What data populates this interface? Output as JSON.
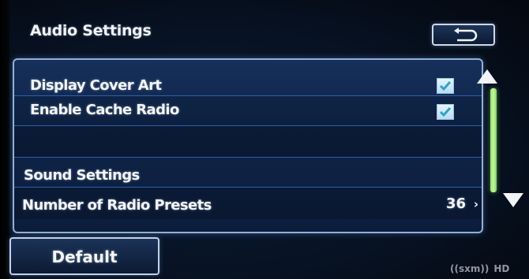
{
  "header": {
    "title": "Audio Settings",
    "back_icon": "back-return-icon"
  },
  "settings": [
    {
      "label": "Display Cover Art",
      "type": "checkbox",
      "checked": true
    },
    {
      "label": "Enable Cache Radio",
      "type": "checkbox",
      "checked": true
    },
    {
      "label": "",
      "type": "empty"
    },
    {
      "label": "Sound Settings",
      "type": "link"
    },
    {
      "label": "Number of Radio Presets",
      "type": "value",
      "value": "36",
      "chevron": "›"
    }
  ],
  "footer": {
    "default_label": "Default",
    "logos": {
      "sxm": "((sxm))",
      "hd": "HD"
    }
  },
  "colors": {
    "accent_border": "#8fb0d8",
    "scroll_thumb": "#a6ee7f",
    "text": "#f4f6fa"
  }
}
